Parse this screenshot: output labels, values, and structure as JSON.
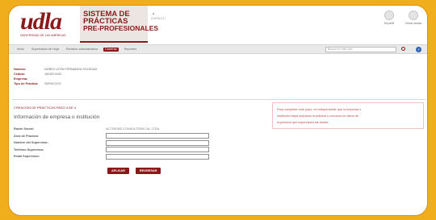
{
  "colors": {
    "frame": "#f0ad1c",
    "brand": "#8a1a1a",
    "help": "#2f62b3"
  },
  "header": {
    "logo_text": "udla",
    "logo_subtitle": "UNIVERSIDAD DE LAS AMÉRICAS",
    "title_line1": "SISTEMA DE",
    "title_line2": "PRÁCTICAS",
    "title_line3": "PRE-PROFESIONALES",
    "env_label": "(DEFAULT)",
    "icons": [
      {
        "icon": "user-icon",
        "label": "Mi perfil"
      },
      {
        "icon": "logout-icon",
        "label": "Cerrar sesión"
      }
    ]
  },
  "nav": {
    "items": [
      "Inicio",
      "Supervisión de Hoja",
      "Revisión administrativa",
      "Carreras",
      "Reportes"
    ],
    "active_index": 3,
    "search_placeholder": "Buscar en este sitio",
    "help_label": "?"
  },
  "student": {
    "nombre_label": "Nombre:",
    "nombre_value": "NÚÑEZ LEÓN FERNANDA SOLEDAD",
    "cedula_label": "Cédula:",
    "cedula_value": "1603574432",
    "empresa_label": "Empresa:",
    "empresa_value": "",
    "tipo_label": "Tipo de Práctica:",
    "tipo_value": "SERVICIOS"
  },
  "section_title": "CREACIÓN DE PRÁCTICAS PASO 4 DE 4",
  "form": {
    "title": "Información de empresa o institución",
    "rows": [
      {
        "label": "Razón Social:",
        "value": "ACTIVIDAD CONSULTORA CIA. LTDA."
      },
      {
        "label": "Área de Práctica:",
        "value": ""
      },
      {
        "label": "Nombre del Supervisor:",
        "value": ""
      },
      {
        "label": "Teléfono Supervisor:",
        "value": ""
      },
      {
        "label": "Email Supervisor:",
        "value": ""
      }
    ],
    "submit_label": "APLICAR",
    "back_label": "REGRESAR"
  },
  "notice": {
    "line1": "Para completar este paso, es indispensable que la empresa o",
    "line2": "institución haya aceptado la práctica y conozca los datos de",
    "line3": "la persona que supervisará las tareas."
  }
}
